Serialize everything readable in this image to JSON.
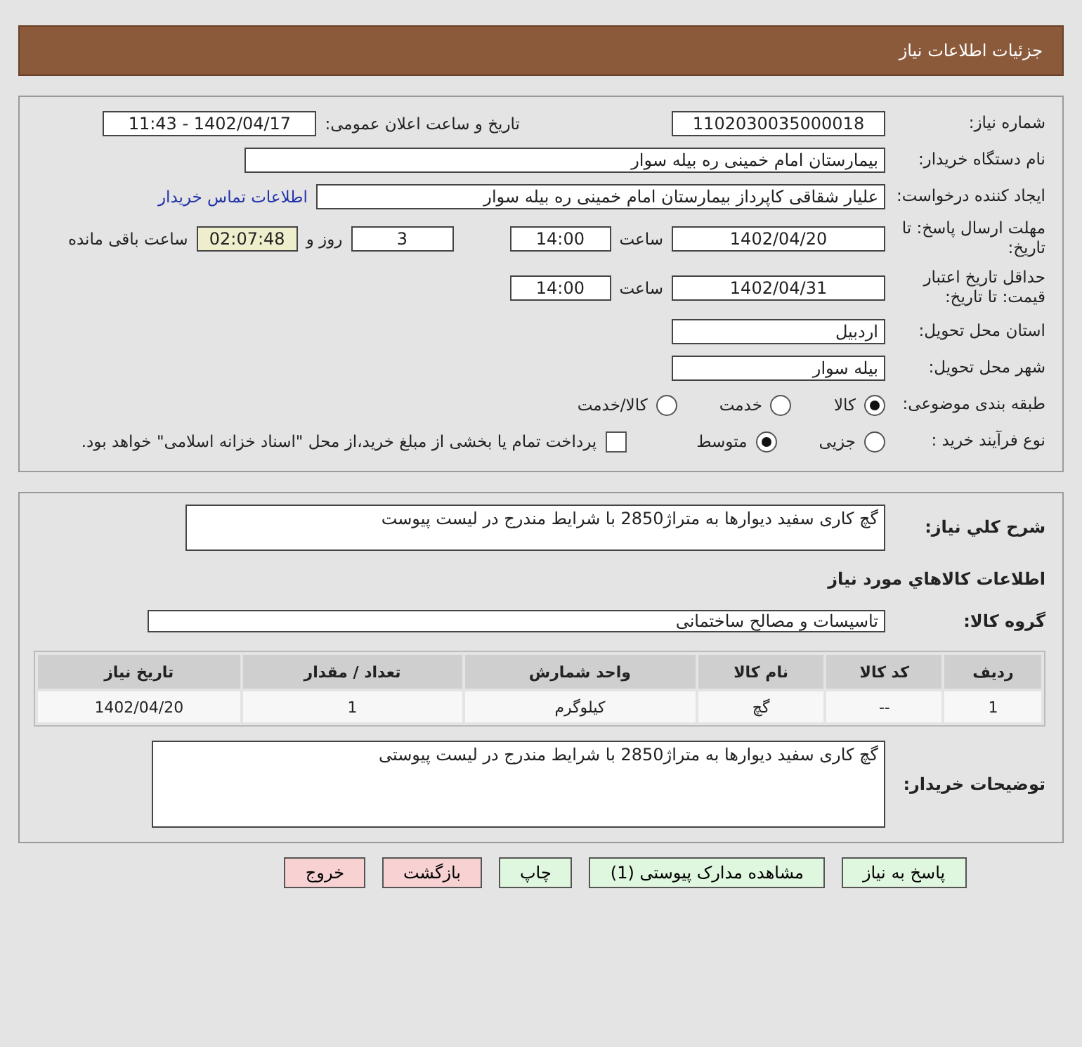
{
  "header": {
    "title": "جزئیات اطلاعات نیاز"
  },
  "need_number": {
    "label": "شماره نیاز:",
    "value": "1102030035000018"
  },
  "announce": {
    "label": "تاریخ و ساعت اعلان عمومی:",
    "value": "1402/04/17 - 11:43"
  },
  "buyer_org": {
    "label": "نام دستگاه خریدار:",
    "value": "بیمارستان امام خمینی ره  بیله سوار"
  },
  "requester": {
    "label": "ایجاد کننده درخواست:",
    "value": "علیار شقاقی کاپرداز بیمارستان امام خمینی ره  بیله سوار",
    "link": "اطلاعات تماس خریدار"
  },
  "response_deadline": {
    "label": "مهلت ارسال پاسخ: تا تاریخ:",
    "date": "1402/04/20",
    "time_label": "ساعت",
    "time": "14:00",
    "days": "3",
    "days_label": "روز و",
    "remaining": "02:07:48",
    "remaining_label": "ساعت باقی مانده"
  },
  "price_validity": {
    "label": "حداقل تاریخ اعتبار قیمت: تا تاریخ:",
    "date": "1402/04/31",
    "time_label": "ساعت",
    "time": "14:00"
  },
  "province": {
    "label": "استان محل تحویل:",
    "value": "اردبیل"
  },
  "city": {
    "label": "شهر محل تحویل:",
    "value": "بیله سوار"
  },
  "category": {
    "label": "طبقه بندی موضوعی:",
    "options": [
      {
        "label": "کالا",
        "selected": true
      },
      {
        "label": "خدمت",
        "selected": false
      },
      {
        "label": "کالا/خدمت",
        "selected": false
      }
    ]
  },
  "process": {
    "label": "نوع فرآیند خرید :",
    "options": [
      {
        "label": "جزیی",
        "selected": false
      },
      {
        "label": "متوسط",
        "selected": true
      }
    ],
    "payment": {
      "checked": false,
      "text": "پرداخت تمام یا بخشی از مبلغ خرید،از محل \"اسناد خزانه اسلامی\" خواهد بود."
    }
  },
  "description": {
    "label": "شرح کلي نیاز:",
    "value": "گچ کاری سفید دیوارها به متراژ2850 با شرایط مندرج در لیست پیوست"
  },
  "items_heading": "اطلاعات کالاهاي مورد نیاز",
  "goods_group": {
    "label": "گروه کالا:",
    "value": "تاسیسات و مصالح ساختمانی"
  },
  "table": {
    "columns": [
      "ردیف",
      "کد کالا",
      "نام کالا",
      "واحد شمارش",
      "تعداد / مقدار",
      "تاریخ نیاز"
    ],
    "rows": [
      [
        "1",
        "--",
        "گچ",
        "کیلوگرم",
        "1",
        "1402/04/20"
      ]
    ]
  },
  "buyer_notes": {
    "label": "توضیحات خریدار:",
    "value": "گچ کاری سفید دیوارها به متراژ2850 با شرایط مندرج در لیست پیوستی"
  },
  "buttons": [
    {
      "label": "پاسخ به نیاز",
      "kind": "action"
    },
    {
      "label": "مشاهده مدارک پیوستی (1)",
      "kind": "action"
    },
    {
      "label": "چاپ",
      "kind": "action"
    },
    {
      "label": "بازگشت",
      "kind": "exit"
    },
    {
      "label": "خروج",
      "kind": "exit"
    }
  ]
}
